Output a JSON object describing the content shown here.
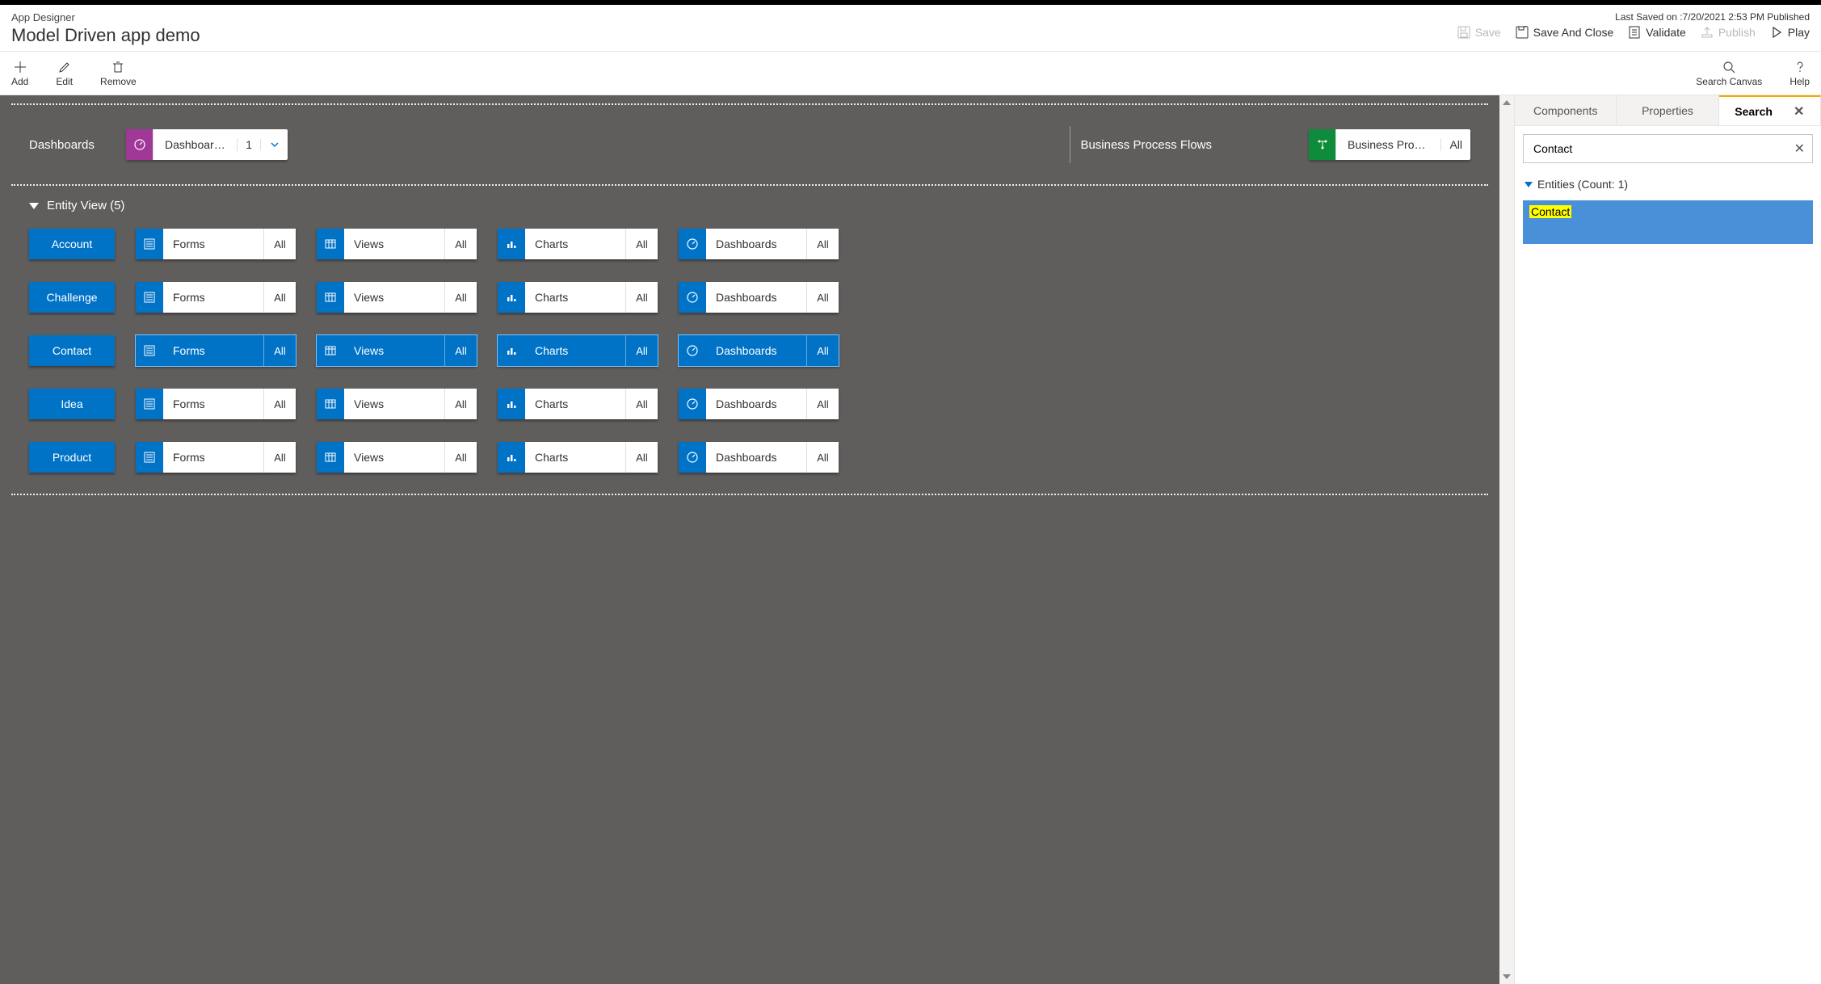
{
  "header": {
    "breadcrumb": "App Designer",
    "title": "Model Driven app demo",
    "status": "Last Saved on :7/20/2021 2:53 PM Published",
    "commands": {
      "save": "Save",
      "save_and_close": "Save And Close",
      "validate": "Validate",
      "publish": "Publish",
      "play": "Play"
    }
  },
  "toolbar": {
    "add": "Add",
    "edit": "Edit",
    "remove": "Remove",
    "search_canvas": "Search Canvas",
    "help": "Help"
  },
  "canvas": {
    "dashboards_label": "Dashboards",
    "dashboards_pill": {
      "label": "Dashboards",
      "count": "1"
    },
    "bpf_label": "Business Process Flows",
    "bpf_pill": {
      "label": "Business Proces…",
      "count": "All"
    },
    "entity_view_label": "Entity View (5)",
    "asset_labels": {
      "forms": "Forms",
      "views": "Views",
      "charts": "Charts",
      "dashboards": "Dashboards",
      "all": "All"
    },
    "entities": [
      {
        "name": "Account",
        "highlight": false
      },
      {
        "name": "Challenge",
        "highlight": false
      },
      {
        "name": "Contact",
        "highlight": true
      },
      {
        "name": "Idea",
        "highlight": false
      },
      {
        "name": "Product",
        "highlight": false
      }
    ]
  },
  "rpanel": {
    "tabs": {
      "components": "Components",
      "properties": "Properties",
      "search": "Search"
    },
    "search_value": "Contact",
    "results_header": "Entities (Count: 1)",
    "result_label": "Contact"
  }
}
